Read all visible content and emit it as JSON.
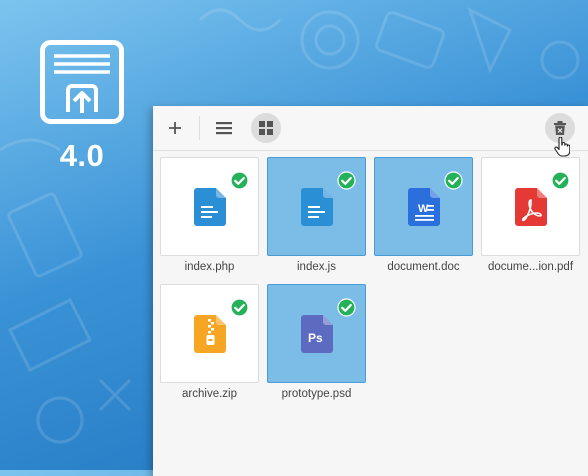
{
  "brand": {
    "version": "4.0",
    "logo_icon": "upload-tray-icon"
  },
  "toolbar": {
    "add_icon": "plus-icon",
    "list_view_icon": "list-view-icon",
    "grid_view_icon": "grid-view-icon",
    "active_view": "grid",
    "clear_icon": "trash-close-icon"
  },
  "files": [
    {
      "name": "index.php",
      "type": "doc",
      "icon": "document-icon",
      "color": "#2b8fd6",
      "selected": false,
      "uploaded": true
    },
    {
      "name": "index.js",
      "type": "doc",
      "icon": "document-icon",
      "color": "#2b8fd6",
      "selected": true,
      "uploaded": true
    },
    {
      "name": "document.doc",
      "type": "word",
      "icon": "word-icon",
      "color": "#2a6fdb",
      "selected": true,
      "uploaded": true
    },
    {
      "name": "docume...ion.pdf",
      "type": "pdf",
      "icon": "pdf-icon",
      "color": "#e53935",
      "selected": false,
      "uploaded": true
    },
    {
      "name": "archive.zip",
      "type": "zip",
      "icon": "zip-icon",
      "color": "#f6a623",
      "selected": false,
      "uploaded": true
    },
    {
      "name": "prototype.psd",
      "type": "psd",
      "icon": "photoshop-icon",
      "color": "#5c6bc0",
      "selected": true,
      "uploaded": true
    }
  ],
  "colors": {
    "selected_tile": "#7bbde7",
    "check": "#24b15a"
  }
}
